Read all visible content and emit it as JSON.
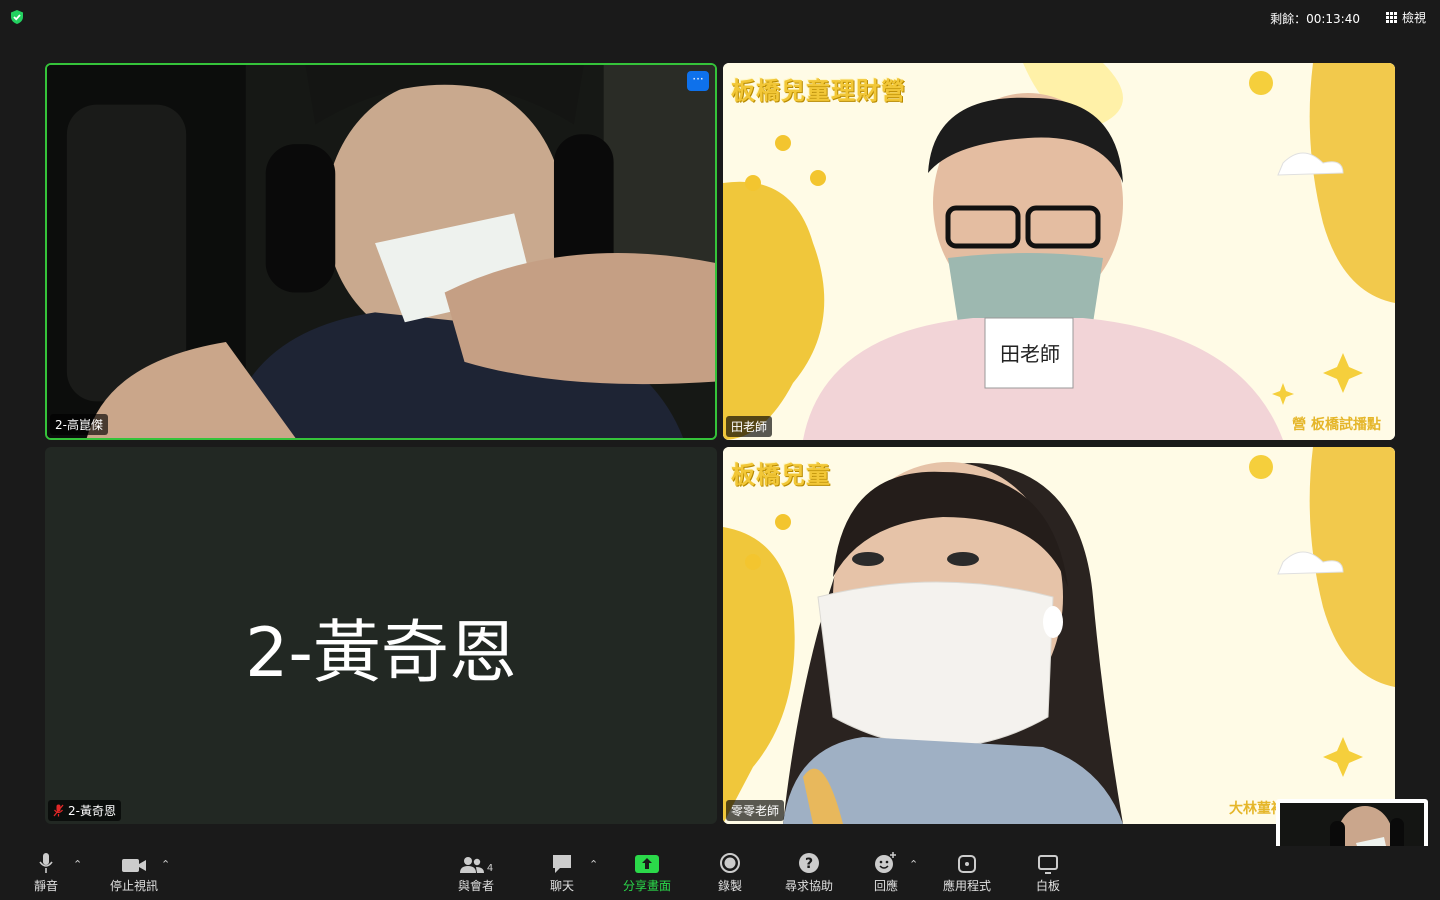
{
  "topbar": {
    "timer": "剩餘：00:13:40",
    "view_label": "檢視"
  },
  "participants": [
    {
      "name": "2-高崑傑",
      "active_speaker": true
    },
    {
      "name": "田老師",
      "background_title": "板橋兒童理財營",
      "background_footer": "營 板橋試播點",
      "name_card": "田老師"
    },
    {
      "name": "2-黃奇恩",
      "display_big": "2-黃奇恩",
      "muted": true
    },
    {
      "name": "零零老師",
      "background_title": "板橋兒童",
      "background_footer": "大林菫補"
    }
  ],
  "toolbar": {
    "mute": "靜音",
    "stop_video": "停止視訊",
    "participants": "與會者",
    "participants_count": "4",
    "chat": "聊天",
    "share_screen": "分享畫面",
    "record": "錄製",
    "ask_help": "尋求協助",
    "reactions": "回應",
    "apps": "應用程式",
    "whiteboard": "白板"
  },
  "colors": {
    "active_speaker_border": "#35c33a",
    "share_green": "#2bd94a",
    "mute_red": "#e02828",
    "accent_blue": "#0e71eb",
    "bg_yellow": "#f2c737"
  },
  "icons": [
    "shield-icon",
    "grid-icon",
    "more-icon",
    "mic-icon",
    "camera-icon",
    "participants-icon",
    "chat-icon",
    "share-icon",
    "record-icon",
    "help-icon",
    "reaction-icon",
    "apps-icon",
    "whiteboard-icon",
    "mic-off-icon"
  ]
}
